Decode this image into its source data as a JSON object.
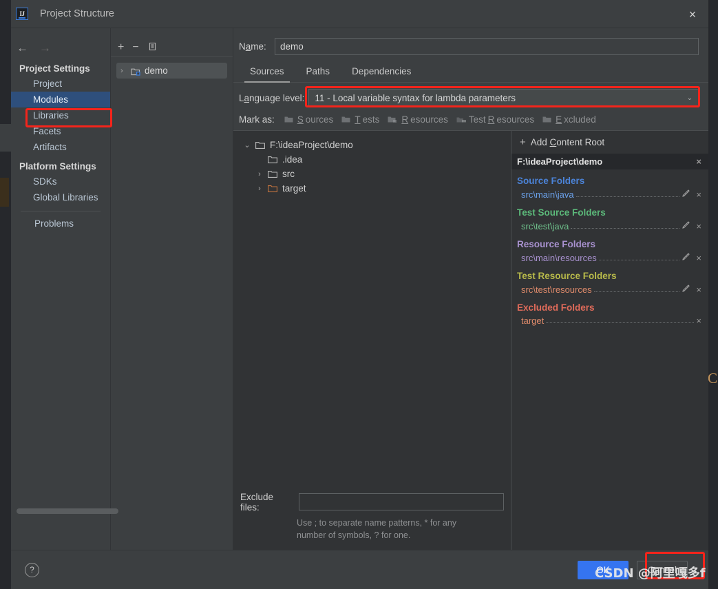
{
  "window": {
    "title": "Project Structure",
    "logo_text": "IJ",
    "close_icon": "×"
  },
  "sidebar": {
    "back_arrow": "←",
    "forward_arrow": "→",
    "groups": [
      {
        "title": "Project Settings",
        "items": [
          {
            "label": "Project",
            "selected": false
          },
          {
            "label": "Modules",
            "selected": true
          },
          {
            "label": "Libraries",
            "selected": false
          },
          {
            "label": "Facets",
            "selected": false
          },
          {
            "label": "Artifacts",
            "selected": false
          }
        ]
      },
      {
        "title": "Platform Settings",
        "items": [
          {
            "label": "SDKs",
            "selected": false
          },
          {
            "label": "Global Libraries",
            "selected": false
          }
        ]
      }
    ],
    "problems_label": "Problems"
  },
  "module_column": {
    "toolbar": {
      "add_icon": "+",
      "remove_icon": "−",
      "copy_icon": "copy-icon"
    },
    "modules": [
      {
        "name": "demo",
        "expander": "›"
      }
    ]
  },
  "main": {
    "name_label_pre": "N",
    "name_label_accel": "a",
    "name_label_post": "me:",
    "name_value": "demo",
    "name_placeholder": "",
    "tabs": [
      {
        "label": "Sources",
        "active": true
      },
      {
        "label": "Paths",
        "active": false
      },
      {
        "label": "Dependencies",
        "active": false
      }
    ],
    "language_level": {
      "label_pre": "L",
      "label_accel": "a",
      "label_post": "nguage level:",
      "value": "11 - Local variable syntax for lambda parameters",
      "caret": "⌄"
    },
    "mark_as": {
      "label": "Mark as:",
      "buttons": [
        {
          "pre": "",
          "accel": "S",
          "post": "ources",
          "icon": "folder-icon"
        },
        {
          "pre": "",
          "accel": "T",
          "post": "ests",
          "icon": "folder-icon"
        },
        {
          "pre": "",
          "accel": "R",
          "post": "esources",
          "icon": "folder-resources-icon"
        },
        {
          "pre": "Test ",
          "accel": "R",
          "post": "esources",
          "icon": "folder-test-resources-icon"
        },
        {
          "pre": "",
          "accel": "E",
          "post": "xcluded",
          "icon": "folder-icon"
        }
      ]
    },
    "tree": [
      {
        "label": "F:\\ideaProject\\demo",
        "expander": "⌄",
        "indent": 0,
        "color": "#d2d2d2",
        "folder": "plain"
      },
      {
        "label": ".idea",
        "expander": "",
        "indent": 2,
        "color": "#d2d2d2",
        "folder": "plain"
      },
      {
        "label": "src",
        "expander": "›",
        "indent": 1,
        "color": "#d2d2d2",
        "folder": "plain"
      },
      {
        "label": "target",
        "expander": "›",
        "indent": 1,
        "color": "#d2d2d2",
        "folder": "orange"
      }
    ],
    "exclude_files": {
      "label": "Exclude files:",
      "value": "",
      "placeholder": "",
      "hint_line1": "Use ; to separate name patterns, * for any",
      "hint_line2": "number of symbols, ? for one."
    }
  },
  "roots_panel": {
    "add_content_root": {
      "plus": "+",
      "pre": "Add ",
      "accel": "C",
      "post": "ontent Root"
    },
    "root_path": "F:\\ideaProject\\demo",
    "root_remove_icon": "×",
    "groups": [
      {
        "title": "Source Folders",
        "color": "#4b83d8",
        "path_color": "#6aa0e8",
        "items": [
          {
            "path": "src\\main\\java",
            "has_pencil": true,
            "pencil_icon": "pencil-icon",
            "remove_icon": "×"
          }
        ]
      },
      {
        "title": "Test Source Folders",
        "color": "#5cb97a",
        "path_color": "#6fc18c",
        "items": [
          {
            "path": "src\\test\\java",
            "has_pencil": true,
            "pencil_icon": "pencil-icon",
            "remove_icon": "×"
          }
        ]
      },
      {
        "title": "Resource Folders",
        "color": "#a992d0",
        "path_color": "#a992d0",
        "items": [
          {
            "path": "src\\main\\resources",
            "has_pencil": true,
            "pencil_icon": "pencil-icon",
            "remove_icon": "×"
          }
        ]
      },
      {
        "title": "Test Resource Folders",
        "color": "#b9bb4a",
        "path_color": "#e08b6b",
        "items": [
          {
            "path": "src\\test\\resources",
            "has_pencil": true,
            "pencil_icon": "pencil-icon",
            "remove_icon": "×"
          }
        ]
      },
      {
        "title": "Excluded Folders",
        "color": "#e06b5a",
        "path_color": "#e08b6b",
        "items": [
          {
            "path": "target",
            "has_pencil": false,
            "pencil_icon": "",
            "remove_icon": "×"
          }
        ]
      }
    ]
  },
  "footer": {
    "help_icon": "?",
    "ok_label": "OK",
    "cancel_label": "Cancel"
  },
  "watermark": {
    "text": "CSDN @阿里嘎多f"
  },
  "background": {
    "right_edge_letter": "C"
  },
  "accents": {
    "highlight_red": "#f5241b",
    "selection_blue": "#2e4f7c",
    "primary_button": "#3574f0"
  }
}
